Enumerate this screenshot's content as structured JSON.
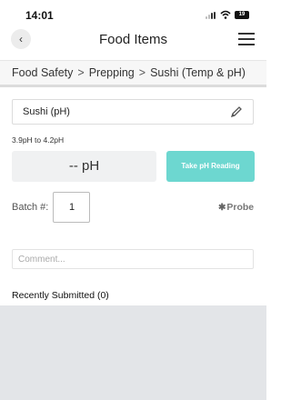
{
  "status_bar": {
    "time": "14:01",
    "battery": "19"
  },
  "nav": {
    "title": "Food Items"
  },
  "breadcrumb": {
    "items": [
      "Food Safety",
      "Prepping",
      "Sushi (Temp & pH)"
    ],
    "separator": ">"
  },
  "item": {
    "name": "Sushi (pH)"
  },
  "range_text": "3.9pH to 4.2pH",
  "reading": {
    "display": "-- pH",
    "button_label": "Take pH Reading"
  },
  "batch": {
    "label": "Batch #:",
    "value": "1"
  },
  "probe": {
    "label": "Probe",
    "icon": "bluetooth-off-icon"
  },
  "comment": {
    "placeholder": "Comment..."
  },
  "recent": {
    "label": "Recently Submitted (0)"
  },
  "colors": {
    "accent": "#6dd7d0",
    "panel": "#e3e5e8"
  }
}
